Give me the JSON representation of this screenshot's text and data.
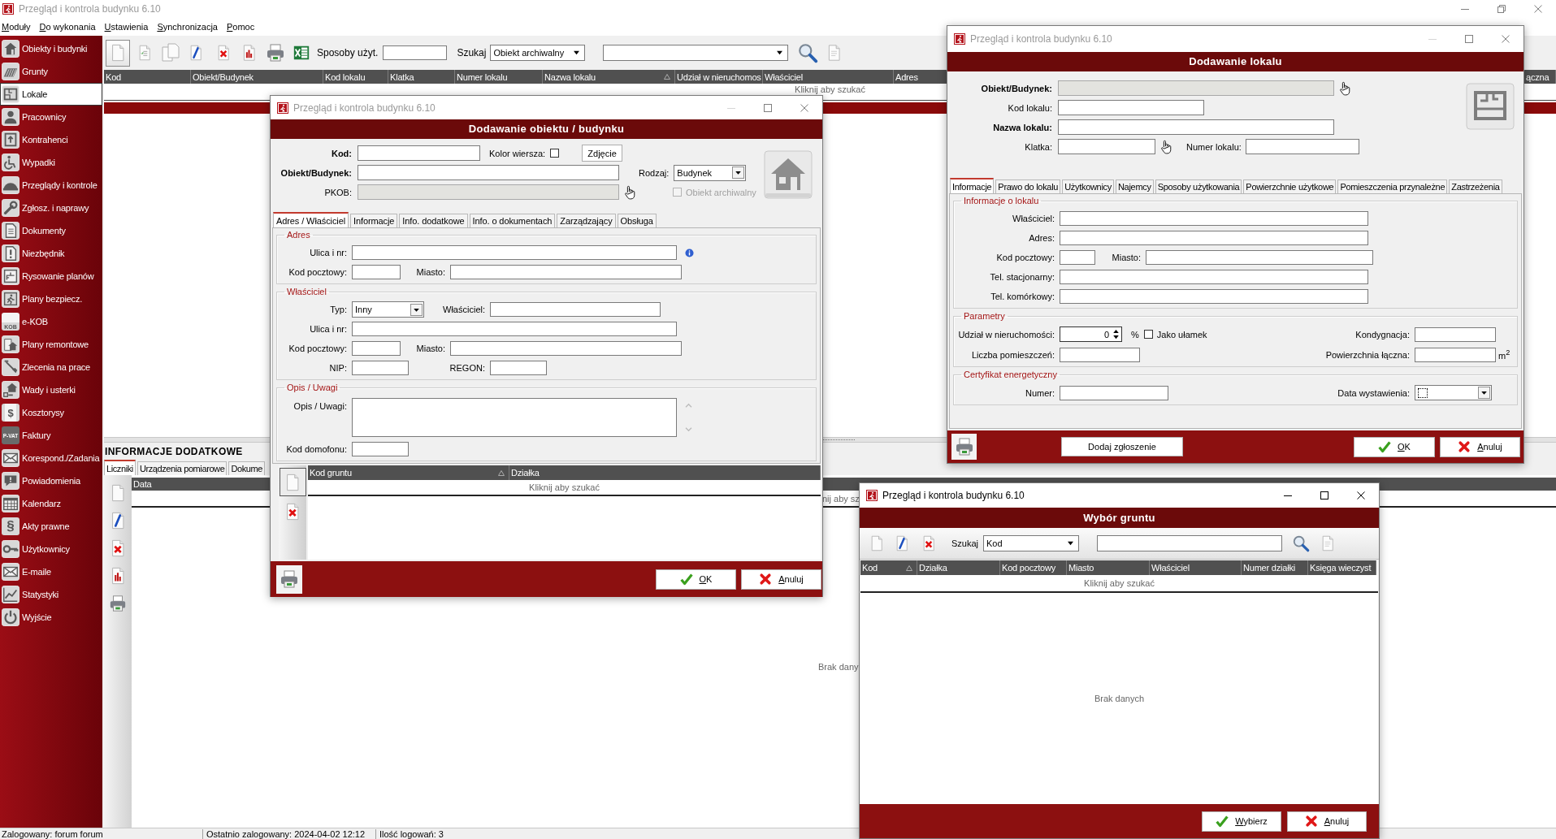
{
  "app_window": {
    "title": "Przegląd i kontrola budynku 6.10",
    "active": false
  },
  "menu": [
    {
      "label": "Moduły",
      "mnemonic": true
    },
    {
      "label": "Do wykonania",
      "mnemonic": true
    },
    {
      "label": "Ustawienia",
      "mnemonic": true
    },
    {
      "label": "Synchronizacja",
      "mnemonic": true
    },
    {
      "label": "Pomoc",
      "mnemonic": true
    }
  ],
  "sidebar": {
    "items": [
      {
        "label": "Obiekty i budynki",
        "selected": false
      },
      {
        "label": "Grunty",
        "selected": false
      },
      {
        "label": "Lokale",
        "selected": true
      },
      {
        "label": "Pracownicy",
        "selected": false
      },
      {
        "label": "Kontrahenci",
        "selected": false
      },
      {
        "label": "Wypadki",
        "selected": false
      },
      {
        "label": "Przeglądy i kontrole",
        "selected": false
      },
      {
        "label": "Zgłosz. i naprawy",
        "selected": false
      },
      {
        "label": "Dokumenty",
        "selected": false
      },
      {
        "label": "Niezbędnik",
        "selected": false
      },
      {
        "label": "Rysowanie planów",
        "selected": false
      },
      {
        "label": "Plany bezpiecz.",
        "selected": false
      },
      {
        "label": "e-KOB",
        "selected": false,
        "badge": "KOB"
      },
      {
        "label": "Plany remontowe",
        "selected": false
      },
      {
        "label": "Zlecenia na prace",
        "selected": false
      },
      {
        "label": "Wady i usterki",
        "selected": false
      },
      {
        "label": "Kosztorysy",
        "selected": false,
        "badge": "$"
      },
      {
        "label": "Faktury",
        "selected": false,
        "badge": "P-VAT"
      },
      {
        "label": "Korespond./Zadania",
        "selected": false
      },
      {
        "label": "Powiadomienia",
        "selected": false
      },
      {
        "label": "Kalendarz",
        "selected": false
      },
      {
        "label": "Akty prawne",
        "selected": false,
        "badge": "§"
      },
      {
        "label": "Użytkownicy",
        "selected": false
      },
      {
        "label": "E-maile",
        "selected": false
      },
      {
        "label": "Statystyki",
        "selected": false
      },
      {
        "label": "Wyjście",
        "selected": false
      }
    ]
  },
  "toolbar": {
    "usage_label": "Sposoby użyt.",
    "search_label": "Szukaj",
    "search_by": "Obiekt archiwalny"
  },
  "table": {
    "columns": [
      {
        "label": "Kod",
        "sorted": false
      },
      {
        "label": "Obiekt/Budynek",
        "sorted": false
      },
      {
        "label": "Kod lokalu",
        "sorted": false
      },
      {
        "label": "Klatka",
        "sorted": false
      },
      {
        "label": "Numer lokalu",
        "sorted": false
      },
      {
        "label": "Nazwa lokalu",
        "sorted": true
      },
      {
        "label": "Udział w nieruchomos",
        "sorted": false
      },
      {
        "label": "Właściciel",
        "sorted": false
      },
      {
        "label": "Adres"
      },
      {
        "label": "ączna",
        "sorted": false
      }
    ],
    "search_row": "Kliknij aby szukać"
  },
  "details": {
    "title": "INFORMACJE DODATKOWE",
    "tabs": [
      {
        "label": "Liczniki",
        "selected": true
      },
      {
        "label": "Urządzenia pomiarowe",
        "selected": false
      },
      {
        "label": "Dokume",
        "selected": false
      }
    ],
    "columns": [
      {
        "label": "Data"
      }
    ],
    "search_row": "nij aby sz",
    "empty_text": "Brak dany"
  },
  "status_bar": [
    "Zalogowany: forum forum",
    "Ostatnio zalogowany: 2024-04-02 12:12",
    "Ilość logowań: 3"
  ],
  "building_dialog": {
    "window_title": "Przegląd i kontrola budynku 6.10",
    "active": false,
    "header": "Dodawanie obiektu / budynku",
    "code": {
      "label": "Kod:",
      "required": true
    },
    "row_color": {
      "label": "Kolor wiersza:",
      "checked": false
    },
    "photo_button": "Zdjęcie",
    "object": {
      "label": "Obiekt/Budynek:",
      "required": true
    },
    "kind": {
      "label": "Rodzaj:",
      "value": "Budynek"
    },
    "pkob": {
      "label": "PKOB:",
      "required": false,
      "disabled": true
    },
    "archived": {
      "label": "Obiekt archiwalny",
      "checked": false,
      "disabled": true
    },
    "tabs": [
      {
        "label": "Adres / Właściciel",
        "selected": true
      },
      {
        "label": "Informacje",
        "selected": false
      },
      {
        "label": "Info. dodatkowe",
        "selected": false
      },
      {
        "label": "Info. o dokumentach",
        "selected": false
      },
      {
        "label": "Zarządzający",
        "selected": false
      },
      {
        "label": "Obsługa",
        "selected": false
      }
    ],
    "address": {
      "title": "Adres",
      "street": "Ulica i nr:",
      "postal_code": "Kod pocztowy:",
      "city": "Miasto:"
    },
    "owner": {
      "title": "Właściciel",
      "type": {
        "label": "Typ:",
        "value": "Inny"
      },
      "owner": "Właściciel:",
      "street": "Ulica i nr:",
      "postal_code": "Kod pocztowy:",
      "city": "Miasto:",
      "nip": "NIP:",
      "regon": "REGON:"
    },
    "notes": {
      "title": "Opis / Uwagi",
      "notes": "Opis / Uwagi:",
      "intercom": "Kod domofonu:"
    },
    "plots": {
      "columns": [
        {
          "label": "Kod gruntu",
          "sorted": true
        },
        {
          "label": "Działka",
          "sorted": false
        }
      ],
      "search_row": "Kliknij aby szukać"
    },
    "buttons": [
      {
        "label": "OK",
        "kind": "ok",
        "mnemonic": true
      },
      {
        "label": "Anuluj",
        "kind": "cancel",
        "mnemonic": true
      }
    ]
  },
  "unit_dialog": {
    "window_title": "Przegląd i kontrola budynku 6.10",
    "active": false,
    "header": "Dodawanie lokalu",
    "object": {
      "label": "Obiekt/Budynek:",
      "required": true,
      "disabled": true
    },
    "unit_code": {
      "label": "Kod lokalu:",
      "required": false
    },
    "unit_name": {
      "label": "Nazwa lokalu:",
      "required": true
    },
    "staircase": {
      "label": "Klatka:",
      "required": false
    },
    "unit_number": {
      "label": "Numer lokalu:"
    },
    "tabs": [
      {
        "label": "Informacje",
        "selected": true
      },
      {
        "label": "Prawo do lokalu",
        "selected": false
      },
      {
        "label": "Użytkownicy",
        "selected": false
      },
      {
        "label": "Najemcy",
        "selected": false
      },
      {
        "label": "Sposoby użytkowania",
        "selected": false
      },
      {
        "label": "Powierzchnie użytkowe",
        "selected": false
      },
      {
        "label": "Pomieszczenia przynależne",
        "selected": false
      },
      {
        "label": "Zastrzeżenia",
        "selected": false
      }
    ],
    "info": {
      "title": "Informacje o lokalu",
      "owner": "Właściciel:",
      "address": "Adres:",
      "postal_code": "Kod pocztowy:",
      "city": "Miasto:",
      "landline": "Tel. stacjonarny:",
      "mobile": "Tel. komórkowy:"
    },
    "parameters": {
      "title": "Parametry",
      "share": {
        "label": "Udział w nieruchomości:",
        "value": "0",
        "unit": "%"
      },
      "as_fraction": {
        "label": "Jako ułamek",
        "checked": false
      },
      "floor": "Kondygnacja:",
      "rooms": "Liczba pomieszczeń:",
      "area": {
        "label": "Powierzchnia łączna:",
        "unit": "m$^{2}$"
      }
    },
    "certificate": {
      "title": "Certyfikat energetyczny",
      "number": "Numer:",
      "issue_date": {
        "label": "Data wystawienia:",
        "checked": false
      }
    },
    "report_button": "Dodaj zgłoszenie",
    "buttons": [
      {
        "label": "OK",
        "kind": "ok",
        "mnemonic": true
      },
      {
        "label": "Anuluj",
        "kind": "cancel",
        "mnemonic": true
      }
    ]
  },
  "plot_dialog": {
    "window_title": "Przegląd i kontrola budynku 6.10",
    "active": true,
    "header": "Wybór gruntu",
    "search_label": "Szukaj",
    "search_by": "Kod",
    "columns": [
      {
        "label": "Kod",
        "sorted": true
      },
      {
        "label": "Działka",
        "sorted": false
      },
      {
        "label": "Kod pocztowy",
        "sorted": false
      },
      {
        "label": "Miasto",
        "sorted": false
      },
      {
        "label": "Właściciel",
        "sorted": false
      },
      {
        "label": "Numer działki",
        "sorted": false
      },
      {
        "label": "Księga wieczyst",
        "sorted": false
      }
    ],
    "search_row": "Kliknij aby szukać",
    "empty_text": "Brak danych",
    "buttons": [
      {
        "label": "Wybierz",
        "kind": "ok",
        "mnemonic": true
      },
      {
        "label": "Anuluj",
        "kind": "cancel",
        "mnemonic": true
      }
    ]
  }
}
